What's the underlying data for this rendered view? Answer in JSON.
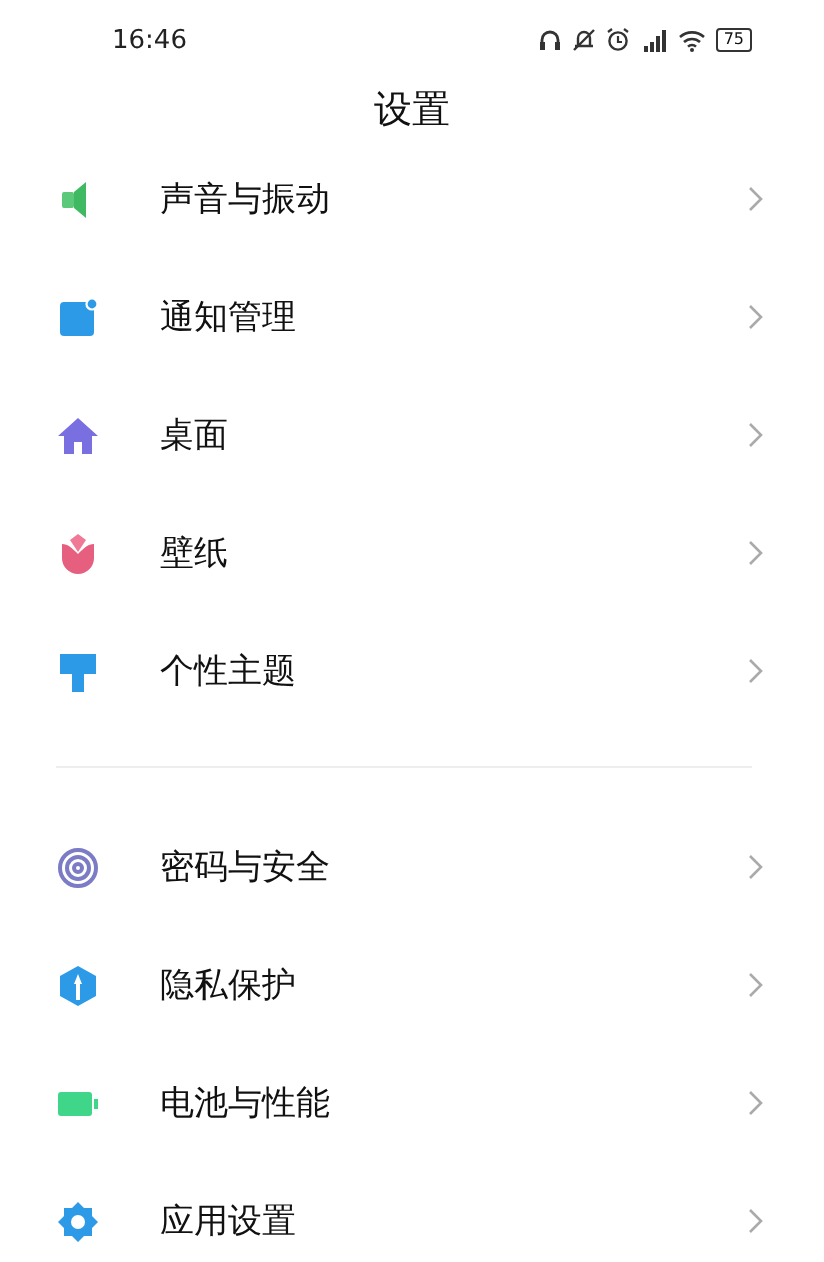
{
  "status_bar": {
    "time": "16:46",
    "battery": "75"
  },
  "title": "设置",
  "groups": [
    {
      "items": [
        {
          "label": "声音与振动",
          "kind": "sound"
        },
        {
          "label": "通知管理",
          "kind": "notify"
        },
        {
          "label": "桌面",
          "kind": "home"
        },
        {
          "label": "壁纸",
          "kind": "wallpaper"
        },
        {
          "label": "个性主题",
          "kind": "theme"
        }
      ]
    },
    {
      "items": [
        {
          "label": "密码与安全",
          "kind": "password"
        },
        {
          "label": "隐私保护",
          "kind": "privacy"
        },
        {
          "label": "电池与性能",
          "kind": "battery"
        },
        {
          "label": "应用设置",
          "kind": "apps"
        }
      ]
    }
  ]
}
